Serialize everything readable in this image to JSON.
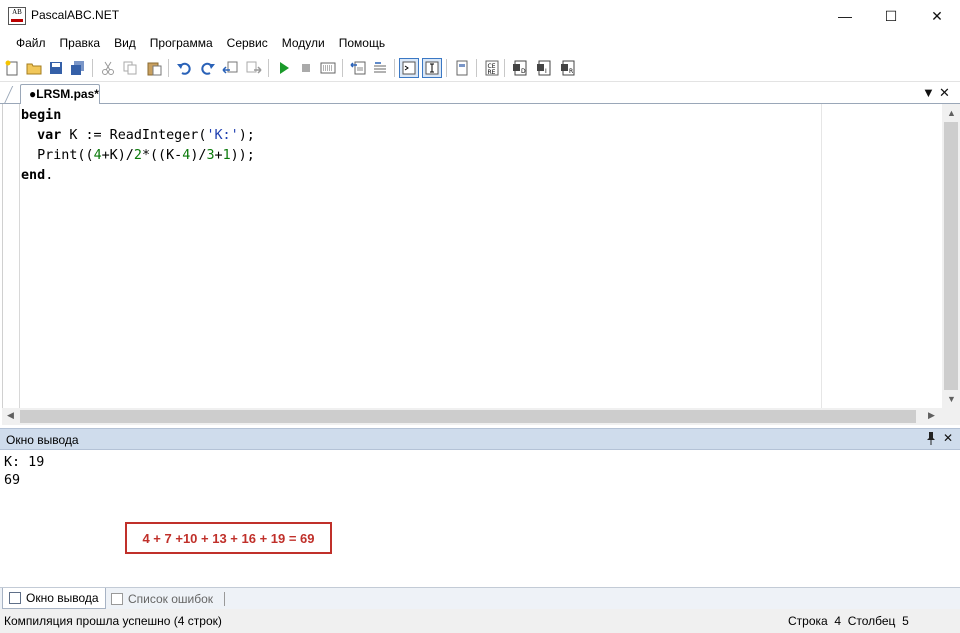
{
  "window": {
    "title": "PascalABC.NET",
    "icon_letters": "AB",
    "min_glyph": "—",
    "max_glyph": "☐",
    "close_glyph": "✕"
  },
  "menu": [
    "Файл",
    "Правка",
    "Вид",
    "Программа",
    "Сервис",
    "Модули",
    "Помощь"
  ],
  "toolbar": {
    "icons": [
      "new-file-icon",
      "open-folder-icon",
      "save-icon",
      "save-all-icon",
      "cut-icon",
      "copy-icon",
      "paste-icon",
      "undo-icon",
      "redo-icon",
      "navigate-back-icon",
      "navigate-forward-icon",
      "run-icon",
      "stop-icon",
      "compile-icon",
      "debug-step-icon",
      "debug-step-over-icon",
      "output-window-toggle-icon",
      "text-toggle-icon",
      "form-designer-icon",
      "code-template-icon",
      "find-icon",
      "find-in-files-icon",
      "replace-icon"
    ],
    "active": [
      "output-window-toggle-icon",
      "text-toggle-icon"
    ]
  },
  "tab": {
    "label": "●LRSM.pas*",
    "dropdown_glyph": "▼",
    "close_glyph": "✕"
  },
  "editor": {
    "line1_kw": "begin",
    "line2_indent": "  ",
    "line2_kw": "var",
    "line2_text": " K := ReadInteger(",
    "line2_str": "'K:'",
    "line2_end": ");",
    "line3_text": "  Print((",
    "line3_n1": "4",
    "line3_t2": "+K)/",
    "line3_n2": "2",
    "line3_t3": "*((K-",
    "line3_n3": "4",
    "line3_t4": ")/",
    "line3_n4": "3",
    "line3_t5": "+",
    "line3_n5": "1",
    "line3_t6": "));",
    "line4_kw": "end",
    "line4_text": "."
  },
  "output_panel": {
    "title": "Окно вывода",
    "pin_glyph": "📌",
    "close_glyph": "✕",
    "lines": [
      "K: 19",
      "69"
    ],
    "annotation": "4 + 7 +10 + 13 + 16 + 19 = 69"
  },
  "bottom_tabs": {
    "output": "Окно вывода",
    "errors": "Список ошибок"
  },
  "status": {
    "message": "Компиляция прошла успешно (4 строк)",
    "position": "Строка  4  Столбец  5"
  },
  "colors": {
    "annotation_border": "#c0302a",
    "panel_header": "#cfdcec",
    "number_literal": "#0a7a0a",
    "string_literal": "#1f3fb0"
  }
}
